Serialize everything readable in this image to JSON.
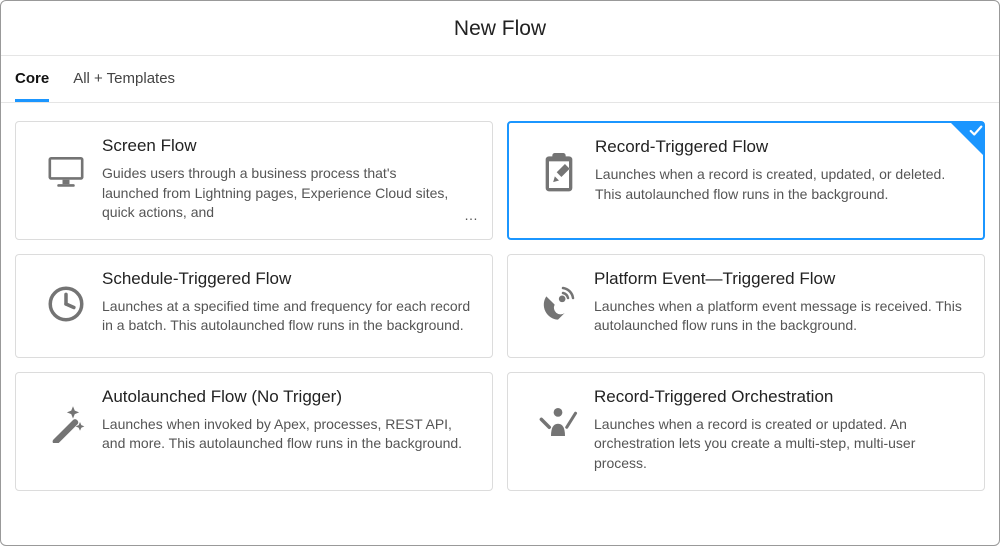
{
  "header": {
    "title": "New Flow"
  },
  "tabs": {
    "core": "Core",
    "all": "All + Templates"
  },
  "cards": {
    "screen": {
      "title": "Screen Flow",
      "desc": "Guides users through a business process that's launched from Lightning pages, Experience Cloud sites, quick actions, and"
    },
    "record": {
      "title": "Record-Triggered Flow",
      "desc": "Launches when a record is created, updated, or deleted. This autolaunched flow runs in the background."
    },
    "schedule": {
      "title": "Schedule-Triggered Flow",
      "desc": "Launches at a specified time and frequency for each record in a batch. This autolaunched flow runs in the background."
    },
    "platform": {
      "title": "Platform Event—Triggered Flow",
      "desc": "Launches when a platform event message is received. This autolaunched flow runs in the background."
    },
    "autolaunched": {
      "title": "Autolaunched Flow (No Trigger)",
      "desc": "Launches when invoked by Apex, processes, REST API, and more. This autolaunched flow runs in the background."
    },
    "orchestration": {
      "title": "Record-Triggered Orchestration",
      "desc": "Launches when a record is created or updated. An orchestration lets you create a multi-step, multi-user process."
    }
  }
}
